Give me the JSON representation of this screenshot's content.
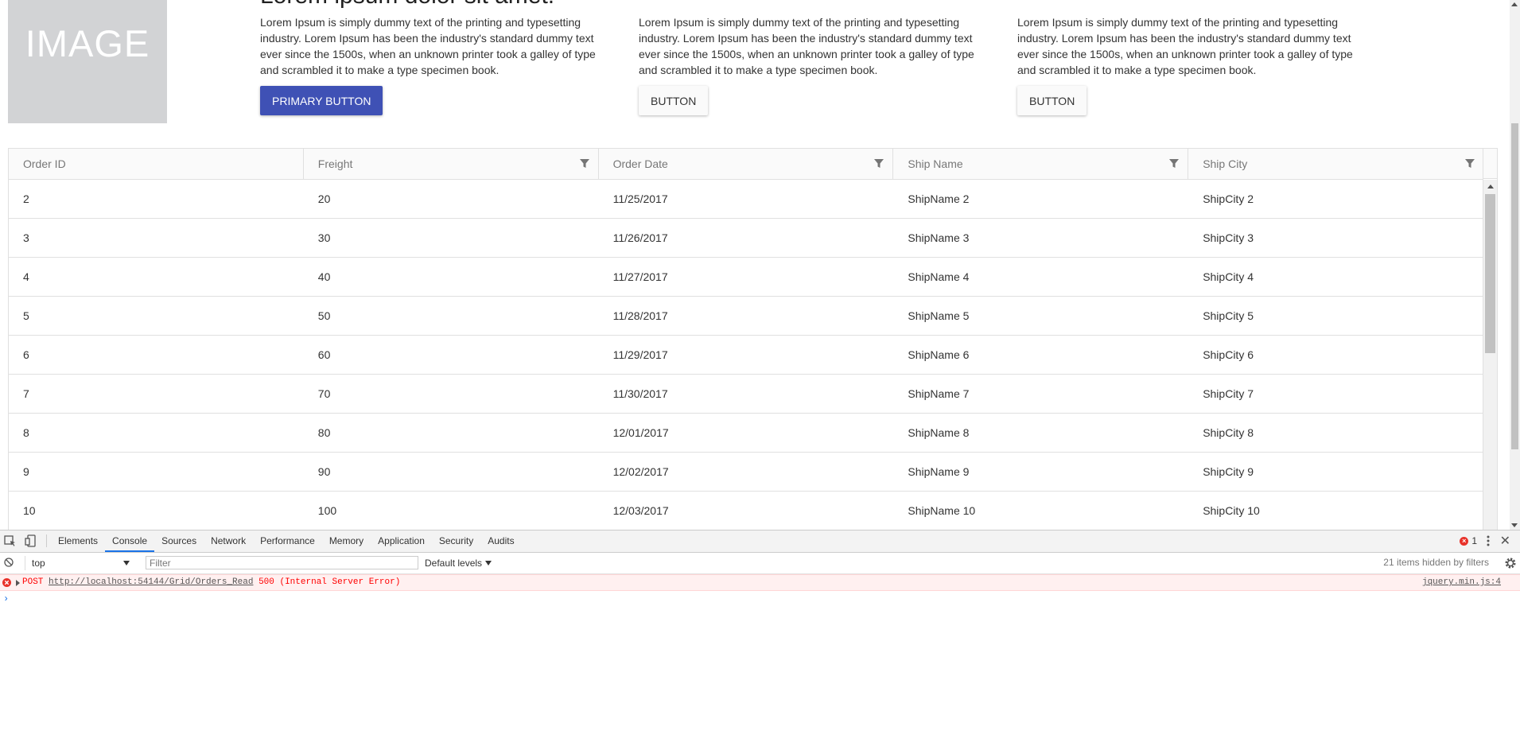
{
  "page": {
    "image_placeholder": "IMAGE",
    "headline": "Lorem ipsum dolor sit amet.",
    "cards": [
      {
        "text": "Lorem Ipsum is simply dummy text of the printing and typesetting industry. Lorem Ipsum has been the industry's standard dummy text ever since the 1500s, when an unknown printer took a galley of type and scrambled it to make a type specimen book.",
        "button": "PRIMARY BUTTON"
      },
      {
        "text": "Lorem Ipsum is simply dummy text of the printing and typesetting industry. Lorem Ipsum has been the industry's standard dummy text ever since the 1500s, when an unknown printer took a galley of type and scrambled it to make a type specimen book.",
        "button": "BUTTON"
      },
      {
        "text": "Lorem Ipsum is simply dummy text of the printing and typesetting industry. Lorem Ipsum has been the industry's standard dummy text ever since the 1500s, when an unknown printer took a galley of type and scrambled it to make a type specimen book.",
        "button": "BUTTON"
      }
    ],
    "primary_color": "#3f51b5"
  },
  "grid": {
    "columns": [
      {
        "label": "Order ID",
        "filterable": false
      },
      {
        "label": "Freight",
        "filterable": true
      },
      {
        "label": "Order Date",
        "filterable": true
      },
      {
        "label": "Ship Name",
        "filterable": true
      },
      {
        "label": "Ship City",
        "filterable": true
      }
    ],
    "rows": [
      [
        "2",
        "20",
        "11/25/2017",
        "ShipName 2",
        "ShipCity 2"
      ],
      [
        "3",
        "30",
        "11/26/2017",
        "ShipName 3",
        "ShipCity 3"
      ],
      [
        "4",
        "40",
        "11/27/2017",
        "ShipName 4",
        "ShipCity 4"
      ],
      [
        "5",
        "50",
        "11/28/2017",
        "ShipName 5",
        "ShipCity 5"
      ],
      [
        "6",
        "60",
        "11/29/2017",
        "ShipName 6",
        "ShipCity 6"
      ],
      [
        "7",
        "70",
        "11/30/2017",
        "ShipName 7",
        "ShipCity 7"
      ],
      [
        "8",
        "80",
        "12/01/2017",
        "ShipName 8",
        "ShipCity 8"
      ],
      [
        "9",
        "90",
        "12/02/2017",
        "ShipName 9",
        "ShipCity 9"
      ],
      [
        "10",
        "100",
        "12/03/2017",
        "ShipName 10",
        "ShipCity 10"
      ]
    ]
  },
  "devtools": {
    "tabs": [
      "Elements",
      "Console",
      "Sources",
      "Network",
      "Performance",
      "Memory",
      "Application",
      "Security",
      "Audits"
    ],
    "active_tab": "Console",
    "error_count": "1",
    "context": "top",
    "filter_placeholder": "Filter",
    "levels": "Default levels",
    "hidden_note": "21 items hidden by filters",
    "console": {
      "method": "POST",
      "url": "http://localhost:54144/Grid/Orders_Read",
      "status": "500 (Internal Server Error)",
      "source": "jquery.min.js:4",
      "prompt": "›"
    },
    "error_color": "#ff0000"
  }
}
